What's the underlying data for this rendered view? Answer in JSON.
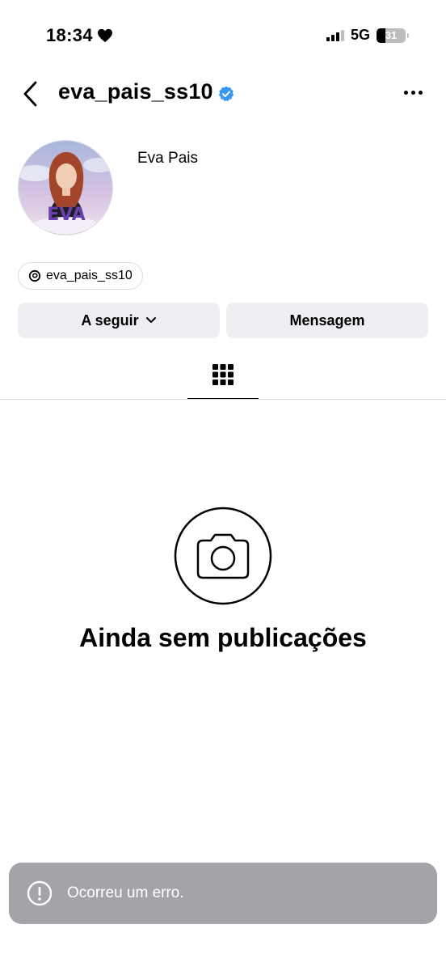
{
  "status_bar": {
    "time": "18:34",
    "network": "5G",
    "battery": "31"
  },
  "header": {
    "username": "eva_pais_ss10"
  },
  "profile": {
    "display_name": "Eva Pais",
    "avatar_text": "EVA",
    "threads_handle": "eva_pais_ss10"
  },
  "actions": {
    "follow_label": "A seguir",
    "message_label": "Mensagem"
  },
  "empty_state": {
    "title": "Ainda sem publicações"
  },
  "toast": {
    "message": "Ocorreu um erro."
  },
  "colors": {
    "verified": "#3897f0",
    "button_bg": "#efeff3",
    "toast_bg": "#a3a4a7"
  }
}
